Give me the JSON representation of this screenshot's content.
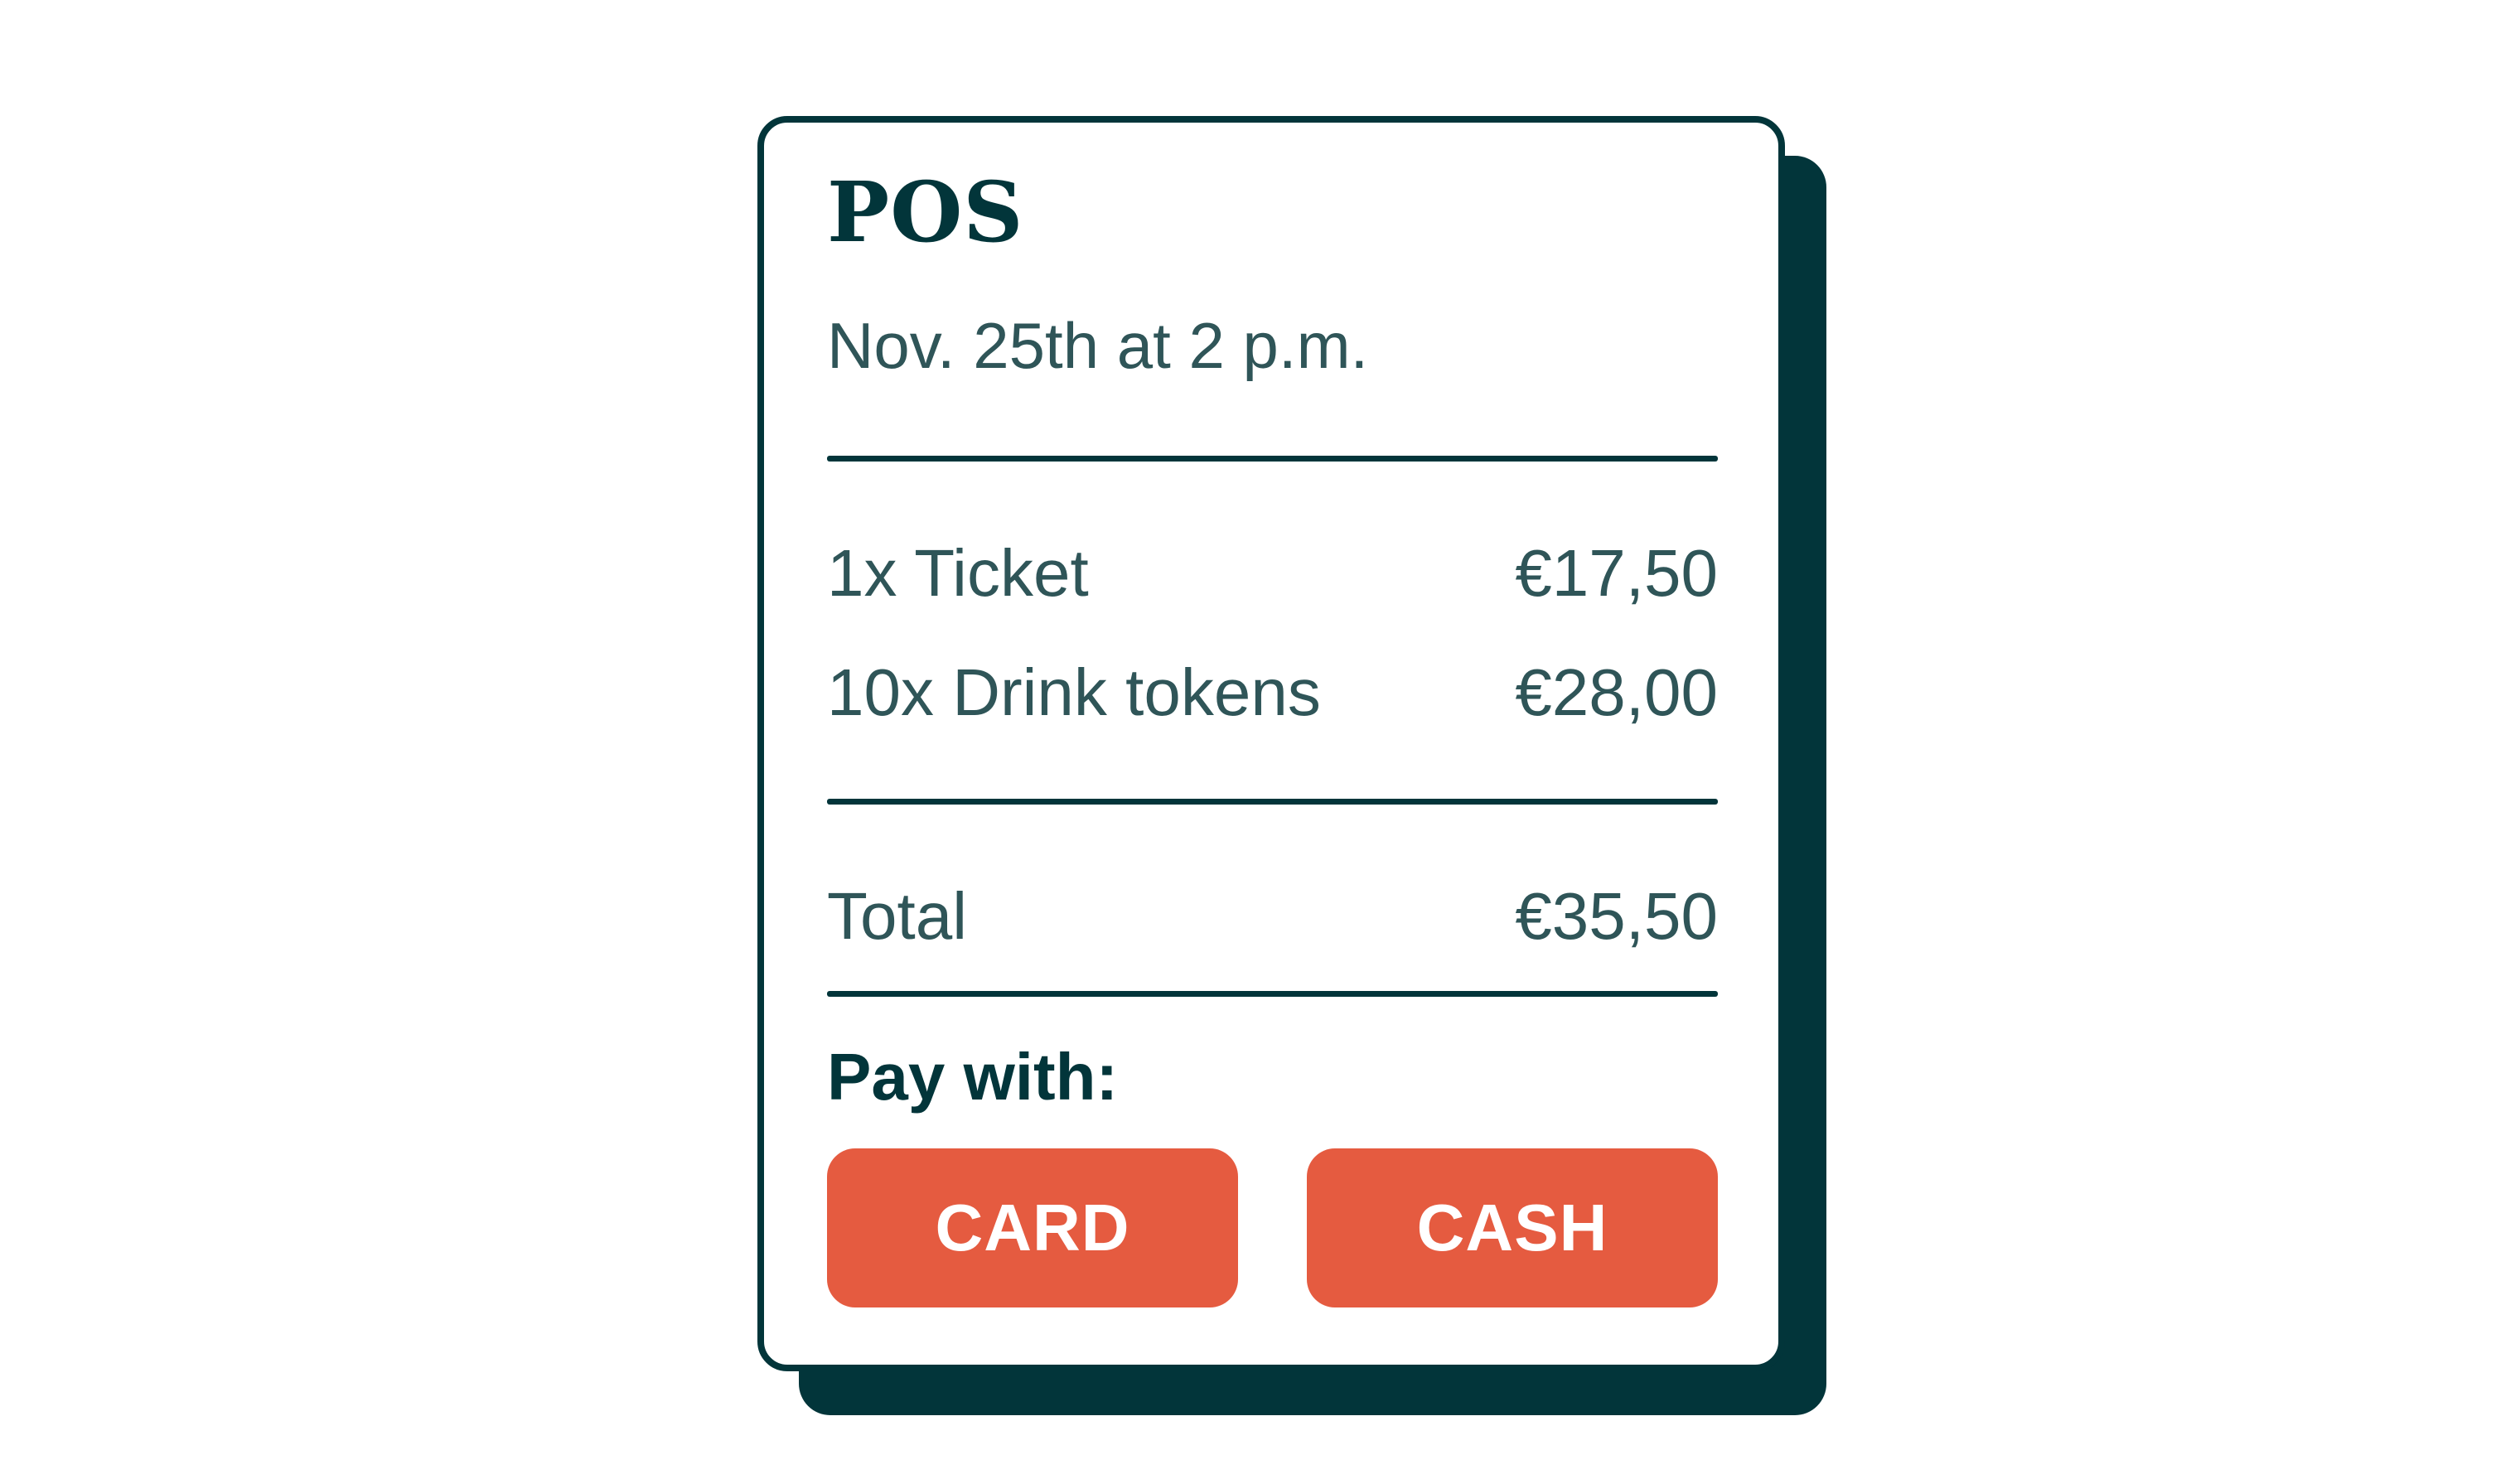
{
  "colors": {
    "primary_dark": "#02353a",
    "text_muted": "#2f5558",
    "accent": "#e55b40",
    "background": "#ffffff"
  },
  "receipt": {
    "title": "POS",
    "date": "Nov. 25th at 2 p.m.",
    "items": [
      {
        "label": "1x Ticket",
        "amount": "€17,50"
      },
      {
        "label": "10x Drink tokens",
        "amount": "€28,00"
      }
    ],
    "total": {
      "label": "Total",
      "amount": "€35,50"
    },
    "pay_with_label": "Pay with:",
    "buttons": {
      "card_label": "CARD",
      "cash_label": "CASH"
    }
  }
}
